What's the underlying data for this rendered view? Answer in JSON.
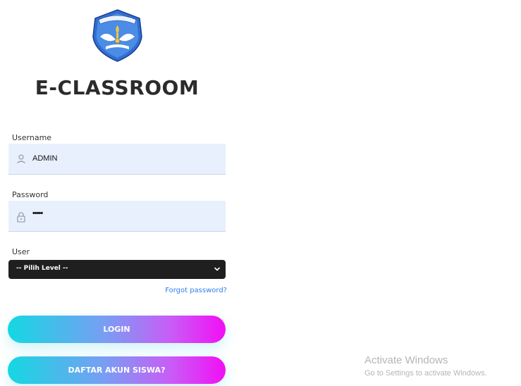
{
  "app": {
    "title": "E-CLASSROOM",
    "logo_icon": "tut-wuri-handayani-emblem",
    "accent_color": "#2f80ed",
    "gradient_start": "#14d8e2",
    "gradient_end": "#f20ef5"
  },
  "form": {
    "username": {
      "label": "Username",
      "value": "ADMIN",
      "icon": "user-icon"
    },
    "password": {
      "label": "Password",
      "masked_value": "•••••",
      "icon": "lock-icon"
    },
    "user_level": {
      "label": "User",
      "selected": "-- Pilih Level --",
      "icon": "chevron-down-icon"
    },
    "forgot_link": "Forgot password?",
    "login_button": "LOGIN",
    "register_button": "DAFTAR AKUN SISWA?"
  },
  "os_overlay": {
    "title": "Activate Windows",
    "subtitle": "Go to Settings to activate Windows."
  }
}
